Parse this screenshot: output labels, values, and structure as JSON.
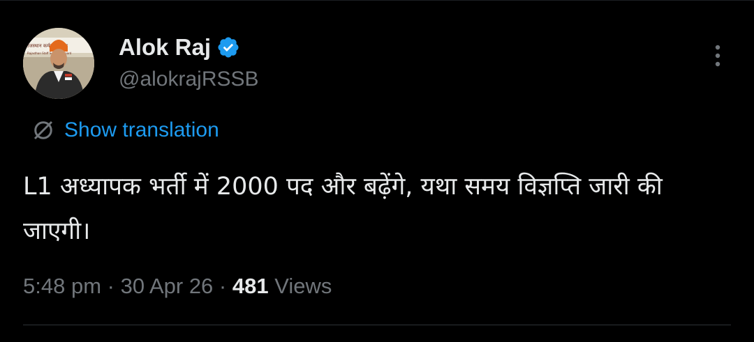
{
  "author": {
    "display_name": "Alok Raj",
    "handle": "@alokrajRSSB",
    "verified": true,
    "avatar_icon": "profile-photo",
    "avatar_banner_text": "राजस्थान कर्मचारी चयन",
    "avatar_banner_sub": "Rajasthan Staff Selection Board"
  },
  "menu": {
    "icon": "more-vertical-icon"
  },
  "translation": {
    "label": "Show translation",
    "icon": "translate-globe-icon"
  },
  "tweet": {
    "text": "L1 अध्यापक भर्ती में 2000 पद और बढ़ेंगे, यथा समय विज्ञप्ति जारी की जाएगी।"
  },
  "meta": {
    "time": "5:48 pm",
    "separator": " · ",
    "date": "30 Apr 26",
    "views_count": "481",
    "views_label": " Views"
  },
  "colors": {
    "background": "#000000",
    "text_primary": "#e7e9ea",
    "text_secondary": "#71767b",
    "accent": "#1d9bf0",
    "divider": "#2f3336"
  }
}
